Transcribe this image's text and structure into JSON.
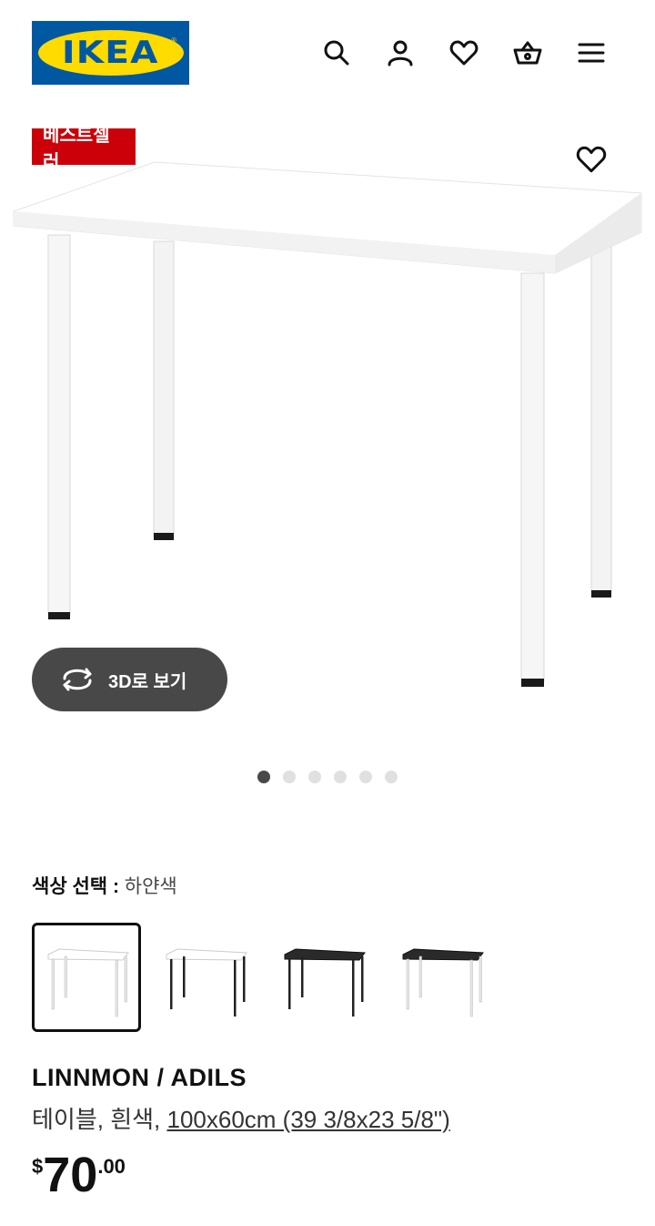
{
  "header": {
    "logo_text": "IKEA",
    "logo_reg": "®",
    "icons": [
      "search-icon",
      "user-icon",
      "heart-icon",
      "basket-icon",
      "menu-icon"
    ]
  },
  "gallery": {
    "badge": "베스트셀러",
    "view_3d_label": "3D로 보기",
    "image_count": 6,
    "active_image": 1
  },
  "color": {
    "label": "색상 선택 :",
    "value": "하얀색",
    "swatches": [
      "white-white",
      "white-black",
      "black-black",
      "black-white"
    ],
    "selected": 0
  },
  "product": {
    "name": "LINNMON / ADILS",
    "desc_prefix": "테이블, 흰색, ",
    "size_link": "100x60cm (39 3/8x23 5/8\")",
    "price_currency": "$",
    "price_integer": "70",
    "price_decimal": ".00"
  },
  "colors": {
    "badge_bg": "#cc0008",
    "logo_blue": "#0058a3",
    "logo_yellow": "#ffdb00",
    "button_dark": "#484848"
  }
}
